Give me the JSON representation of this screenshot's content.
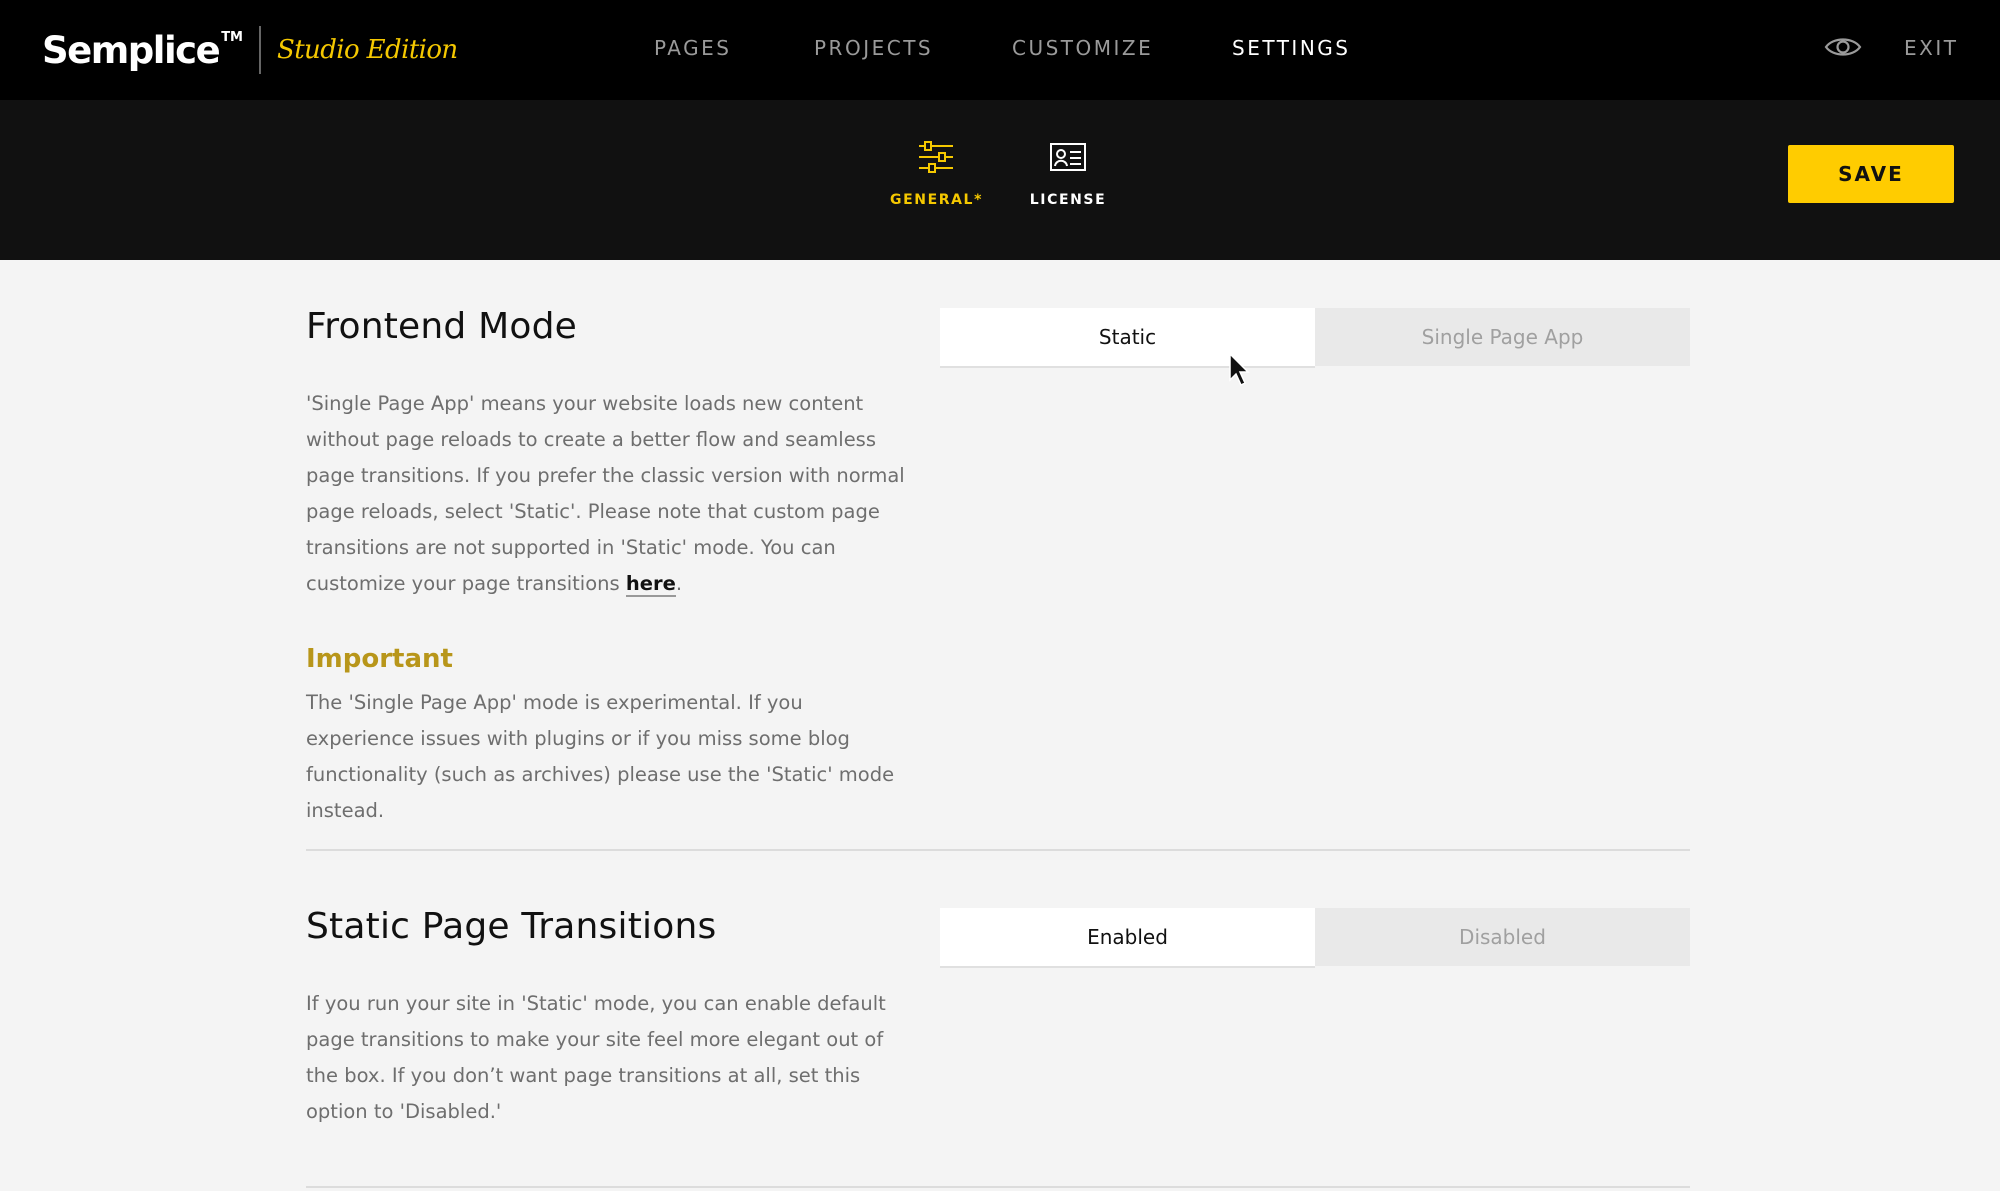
{
  "header": {
    "brand_name": "Semplice",
    "brand_tm": "TM",
    "brand_edition": "Studio Edition",
    "nav": [
      {
        "label": "PAGES"
      },
      {
        "label": "PROJECTS"
      },
      {
        "label": "CUSTOMIZE"
      },
      {
        "label": "SETTINGS",
        "active": true
      }
    ],
    "preview_icon": "eye-icon",
    "exit_label": "EXIT"
  },
  "subnav": {
    "tabs": [
      {
        "label": "GENERAL*",
        "icon": "sliders-icon",
        "active": true
      },
      {
        "label": "LICENSE",
        "icon": "id-card-icon",
        "active": false
      }
    ],
    "save_label": "SAVE"
  },
  "sections": {
    "frontend_mode": {
      "title": "Frontend Mode",
      "description_before_link": "'Single Page App' means your website loads new content without page reloads to create a better flow and seamless page transitions. If you prefer the classic version with normal page reloads, select 'Static'. Please note that custom page transitions are not supported in 'Static' mode. You can customize your page transitions ",
      "link_text": "here",
      "description_after_link": ".",
      "important_heading": "Important",
      "important_text": "The 'Single Page App' mode is experimental. If you experience issues with plugins or if you miss some blog functionality (such as archives) please use the 'Static' mode instead.",
      "options": [
        {
          "label": "Static",
          "selected": true
        },
        {
          "label": "Single Page App",
          "selected": false
        }
      ]
    },
    "page_transitions": {
      "title": "Static Page Transitions",
      "description": "If you run your site in 'Static' mode, you can enable default page transitions to make your site feel more elegant out of the box. If you don’t want page transitions at all, set this option to 'Disabled.'",
      "options": [
        {
          "label": "Enabled",
          "selected": true
        },
        {
          "label": "Disabled",
          "selected": false
        }
      ]
    }
  },
  "colors": {
    "accent": "#ffcc00",
    "accent_text": "#f5c800",
    "important": "#b8961a",
    "header_bg": "#000000",
    "subbar_bg": "#111111",
    "content_bg": "#f4f4f4"
  }
}
